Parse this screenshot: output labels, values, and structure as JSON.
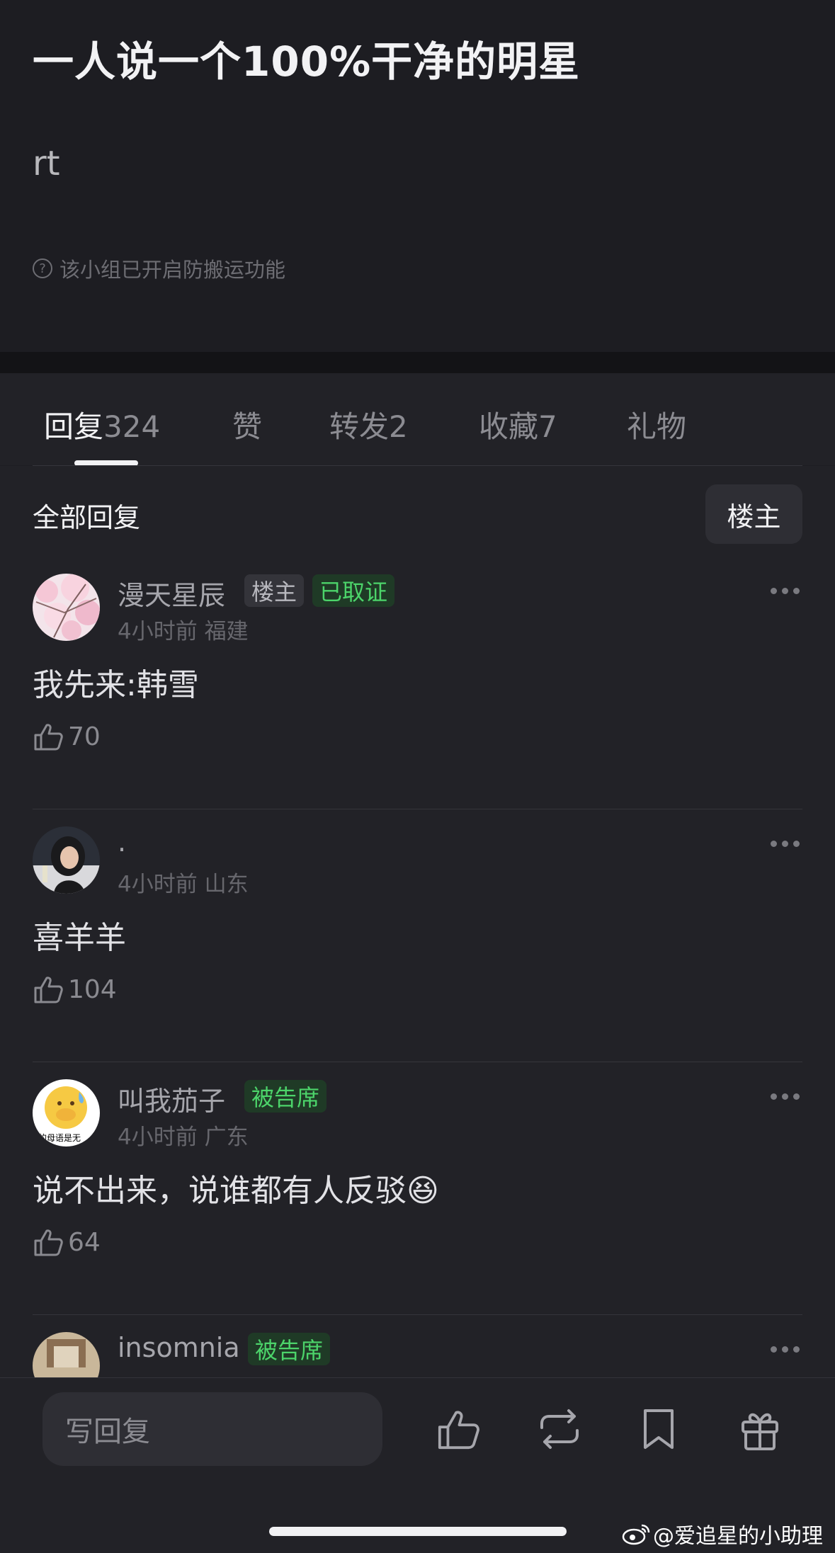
{
  "post": {
    "title": "一人说一个100%干净的明星",
    "body": "rt",
    "notice": "该小组已开启防搬运功能"
  },
  "tabs": [
    {
      "label": "回复",
      "count": "324",
      "active": true
    },
    {
      "label": "赞",
      "count": "",
      "active": false
    },
    {
      "label": "转发",
      "count": "2",
      "active": false
    },
    {
      "label": "收藏",
      "count": "7",
      "active": false
    },
    {
      "label": "礼物",
      "count": "",
      "active": false
    }
  ],
  "replies_header": {
    "title": "全部回复",
    "owner_filter": "楼主"
  },
  "comments": [
    {
      "name": "漫天星辰",
      "badges": [
        "楼主",
        "已取证"
      ],
      "time": "4小时前",
      "location": "福建",
      "text": "我先来:韩雪",
      "likes": "70"
    },
    {
      "name": ".",
      "badges": [],
      "time": "4小时前",
      "location": "山东",
      "text": "喜羊羊",
      "likes": "104"
    },
    {
      "name": "叫我茄子",
      "badges": [
        "被告席"
      ],
      "time": "4小时前",
      "location": "广东",
      "text": "说不出来，说谁都有人反驳",
      "emoji": "😆",
      "likes": "64",
      "avatar_text": "的母语是无"
    },
    {
      "name": "insomnia",
      "badges": [
        "被告席"
      ],
      "time": "",
      "location": "",
      "text": "",
      "likes": ""
    }
  ],
  "bottom_bar": {
    "placeholder": "写回复",
    "icons": [
      "like-icon",
      "repost-icon",
      "bookmark-icon",
      "gift-icon"
    ]
  },
  "watermark": "@爱追星的小助理",
  "colors": {
    "background": "#222227",
    "badge_green": "#4cd46a"
  }
}
